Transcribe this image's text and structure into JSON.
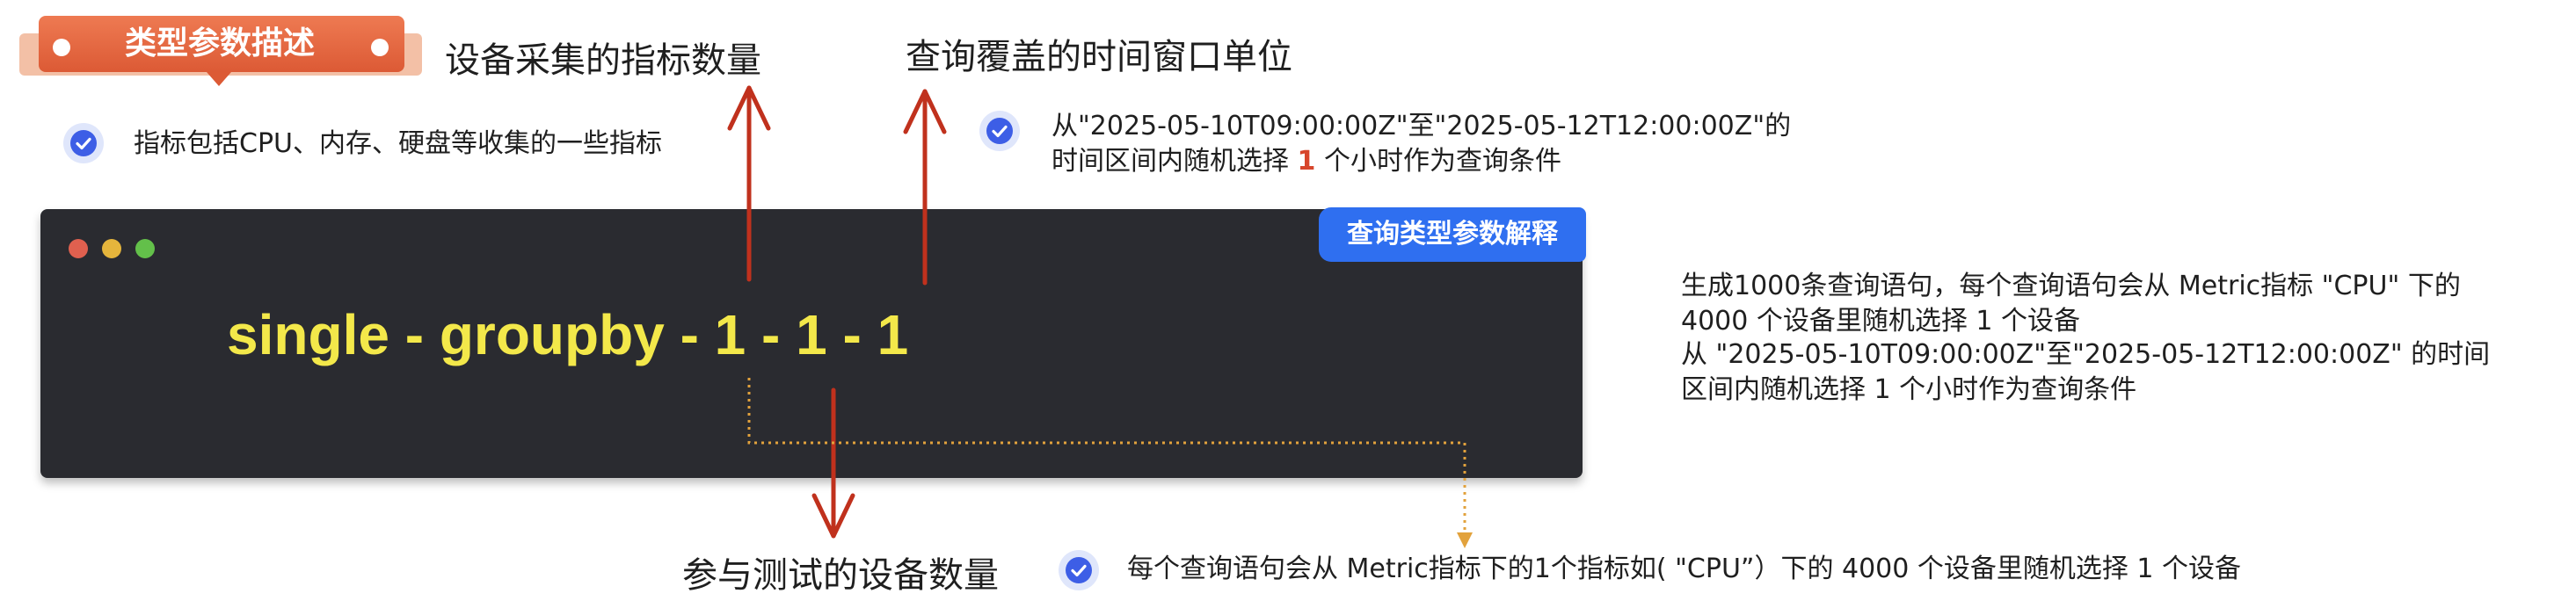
{
  "header": {
    "title": "类型参数描述"
  },
  "labels": {
    "device_metric_count": "设备采集的指标数量",
    "time_window_unit": "查询覆盖的时间窗口单位",
    "device_count": "参与测试的设备数量"
  },
  "notes": {
    "metrics": "指标包括CPU、内存、硬盘等收集的一些指标",
    "time_line1": "从\"2025-05-10T09:00:00Z\"至\"2025-05-12T12:00:00Z\"的",
    "time_line2_pre": "时间区间内随机选择",
    "time_line2_num": "1",
    "time_line2_post": "个小时作为查询条件",
    "devices": "每个查询语句会从 Metric指标下的1个指标如( \"CPU”）下的 4000 个设备里随机选择 1 个设备"
  },
  "terminal": {
    "badge": "查询类型参数解释",
    "command": "single - groupby - 1 - 1 - 1"
  },
  "summary": {
    "line1": "生成1000条查询语句，每个查询语句会从 Metric指标 \"CPU\" 下的",
    "line2": "4000 个设备里随机选择 1 个设备",
    "line3": "从 \"2025-05-10T09:00:00Z\"至\"2025-05-12T12:00:00Z\" 的时间",
    "line4": "区间内随机选择 1 个小时作为查询条件"
  },
  "colors": {
    "ribbon": "#dc5a35",
    "arrow": "#c0311d",
    "dotted_connector": "#e2a23c",
    "command_text": "#f3e84a",
    "terminal_bg": "#2a2b30",
    "badge": "#2f6ff0",
    "check": "#3d5ee6"
  }
}
